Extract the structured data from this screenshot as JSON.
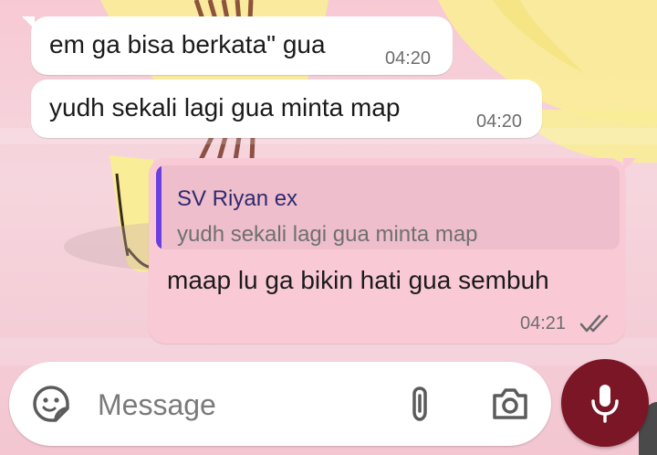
{
  "colors": {
    "incoming_bubble": "#ffffff",
    "outgoing_bubble": "#f9c9d6",
    "reply_bar": "#6a3ee0",
    "mic_button": "#7a1626"
  },
  "messages": [
    {
      "direction": "incoming",
      "text": "em ga bisa berkata\" gua",
      "time": "04:20"
    },
    {
      "direction": "incoming",
      "text": "yudh sekali lagi gua minta map",
      "time": "04:20"
    },
    {
      "direction": "outgoing",
      "reply_to": {
        "author": "SV Riyan ex",
        "snippet": "yudh sekali lagi gua minta map"
      },
      "text": "maap lu ga bikin hati gua sembuh",
      "time": "04:21",
      "status_icon": "double-check-icon"
    }
  ],
  "composer": {
    "placeholder": "Message",
    "emoji_icon": "sticker-icon",
    "attach_icon": "paperclip-icon",
    "camera_icon": "camera-icon",
    "mic_icon": "microphone-icon"
  }
}
